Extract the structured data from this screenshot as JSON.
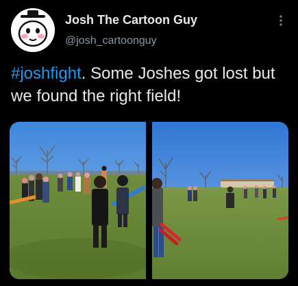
{
  "tweet": {
    "author_name": "Josh The Cartoon Guy",
    "author_handle": "@josh_cartoonguy",
    "hashtag": "#joshfight",
    "text_after_hashtag": ". Some Joshes got lost but we found the right field!",
    "media_count": 2
  },
  "icons": {
    "avatar": "cartoon-face-icon",
    "more": "vertical-dots-icon"
  },
  "colors": {
    "background": "#000000",
    "name": "#e8e8e8",
    "handle": "#8b98a5",
    "body_text": "#e7e9ea",
    "hashtag": "#1d9bf0"
  }
}
